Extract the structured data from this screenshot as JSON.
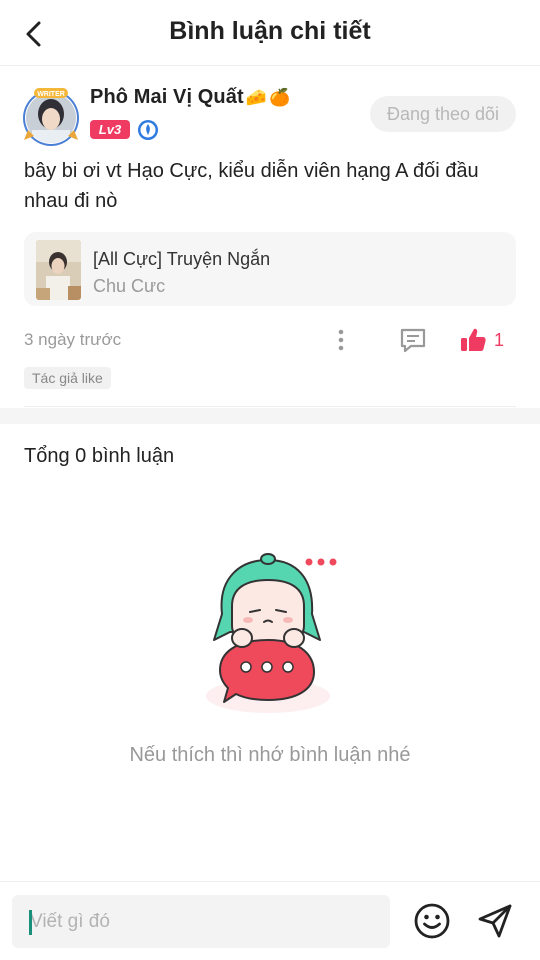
{
  "header": {
    "title": "Bình luận chi tiết",
    "back_icon": "chevron-left-icon"
  },
  "author": {
    "name": "Phô Mai Vị Quất",
    "name_emojis": [
      "🧀",
      "🍊"
    ],
    "avatar_frame_label": "WRITER",
    "level": "Lv3",
    "verify_icon": "shield-badge-icon",
    "follow_label": "Đang theo dõi"
  },
  "comment": {
    "text": "bây bi ơi vt Hạo Cực, kiểu diễn viên hạng A đối đầu nhau đi nò",
    "time": "3 ngày trước",
    "likes": "1",
    "author_like_tag": "Tác giả like"
  },
  "book": {
    "title": "[All Cực] Truyện Ngắn",
    "author": "Chu Cưc"
  },
  "comments_section": {
    "total_label": "Tổng 0 bình luận",
    "empty_text": "Nếu thích thì nhớ bình luận nhé"
  },
  "input": {
    "placeholder": "Viết gì đó",
    "emoji_icon": "smiley-icon",
    "send_icon": "send-icon"
  },
  "colors": {
    "accent": "#ef3b62",
    "muted_text": "#9a9a9a",
    "follow_bg": "#f1f1f1",
    "mascot_hair": "#55d6b0",
    "mascot_bubble": "#ef4a5c"
  }
}
